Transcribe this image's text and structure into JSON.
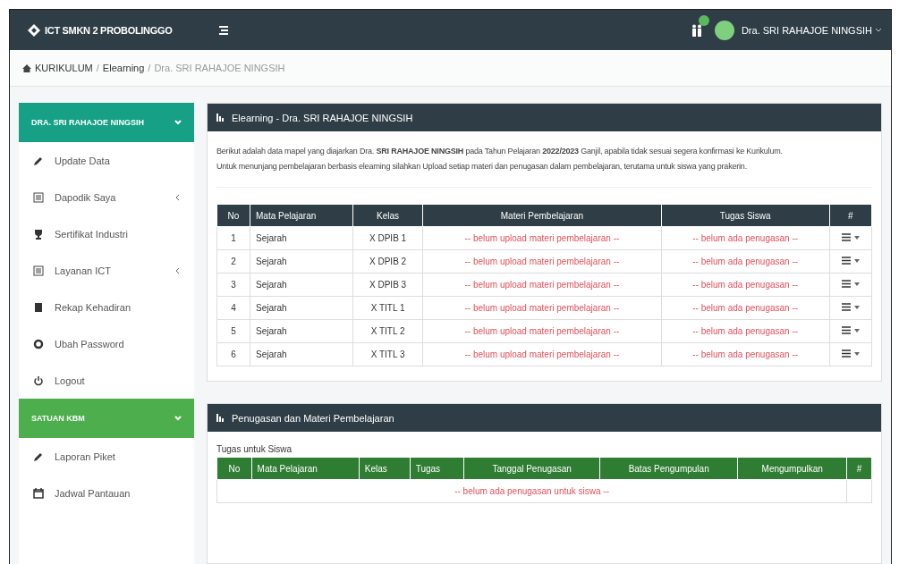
{
  "header": {
    "brand": "ICT SMKN 2 PROBOLINGGO",
    "user": "Dra. SRI RAHAJOE NINGSIH"
  },
  "breadcrumb": [
    {
      "label": "KURIKULUM",
      "current": false,
      "separator": "/"
    },
    {
      "label": "Elearning",
      "current": false,
      "separator": "/"
    },
    {
      "label": "Dra. SRI RAHAJOE NINGSIH",
      "current": true
    }
  ],
  "sidebar": [
    {
      "title": "DRA. SRI RAHAJOE NINGSIH",
      "color": "#16a085",
      "items": [
        {
          "label": "Update Data",
          "submenu": false
        },
        {
          "label": "Dapodik Saya",
          "submenu": true
        },
        {
          "label": "Sertifikat Industri",
          "submenu": false
        },
        {
          "label": "Layanan ICT",
          "submenu": true
        },
        {
          "label": "Rekap Kehadiran",
          "submenu": false
        },
        {
          "label": "Ubah Password",
          "submenu": false
        },
        {
          "label": "Logout",
          "submenu": false
        }
      ]
    },
    {
      "title": "SATUAN KBM",
      "color": "#4cae4c",
      "items": [
        {
          "label": "Laporan Piket",
          "submenu": false
        },
        {
          "label": "Jadwal Pantauan",
          "submenu": false
        }
      ]
    }
  ],
  "elearning": {
    "title": "Elearning - Dra. SRI RAHAJOE NINGSIH",
    "intro": "Berikut adalah data mapel yang diajarkan Dra. **SRI RAHAJOE NINGSIH** pada Tahun Pelajaran **2022/2023** Ganjil, apabila tidak sesuai segera konfirmasi ke Kurikulum.",
    "note": "Untuk menunjang pembelajaran berbasis elearning silahkan Upload setiap materi dan penugasan dalam pembelajaran, terutama untuk siswa yang prakerin.",
    "columns": [
      "No",
      "Mata Pelajaran",
      "Kelas",
      "Materi Pembelajaran",
      "Tugas Siswa",
      "#"
    ],
    "rows": [
      {
        "no": "1",
        "subject": "Sejarah",
        "class": "X DPIB 1",
        "material": "-- belum upload materi pembelajaran --",
        "task": "-- belum ada penugasan --"
      },
      {
        "no": "2",
        "subject": "Sejarah",
        "class": "X DPIB 2",
        "material": "-- belum upload materi pembelajaran --",
        "task": "-- belum ada penugasan --"
      },
      {
        "no": "3",
        "subject": "Sejarah",
        "class": "X DPIB 3",
        "material": "-- belum upload materi pembelajaran --",
        "task": "-- belum ada penugasan --"
      },
      {
        "no": "4",
        "subject": "Sejarah",
        "class": "X TITL 1",
        "material": "-- belum upload materi pembelajaran --",
        "task": "-- belum ada penugasan --"
      },
      {
        "no": "5",
        "subject": "Sejarah",
        "class": "X TITL 2",
        "material": "-- belum upload materi pembelajaran --",
        "task": "-- belum ada penugasan --"
      },
      {
        "no": "6",
        "subject": "Sejarah",
        "class": "X TITL 3",
        "material": "-- belum upload materi pembelajaran --",
        "task": "-- belum ada penugasan --"
      }
    ]
  },
  "assignments": {
    "title": "Penugasan dan Materi Pembelajaran",
    "subtitle": "Tugas untuk Siswa",
    "columns": [
      "No",
      "Mata Pelajaran",
      "Kelas",
      "Tugas",
      "Tanggal Penugasan",
      "Batas Pengumpulan",
      "Mengumpulkan",
      "#"
    ],
    "empty": "-- belum ada penugasan untuk siswa --"
  }
}
